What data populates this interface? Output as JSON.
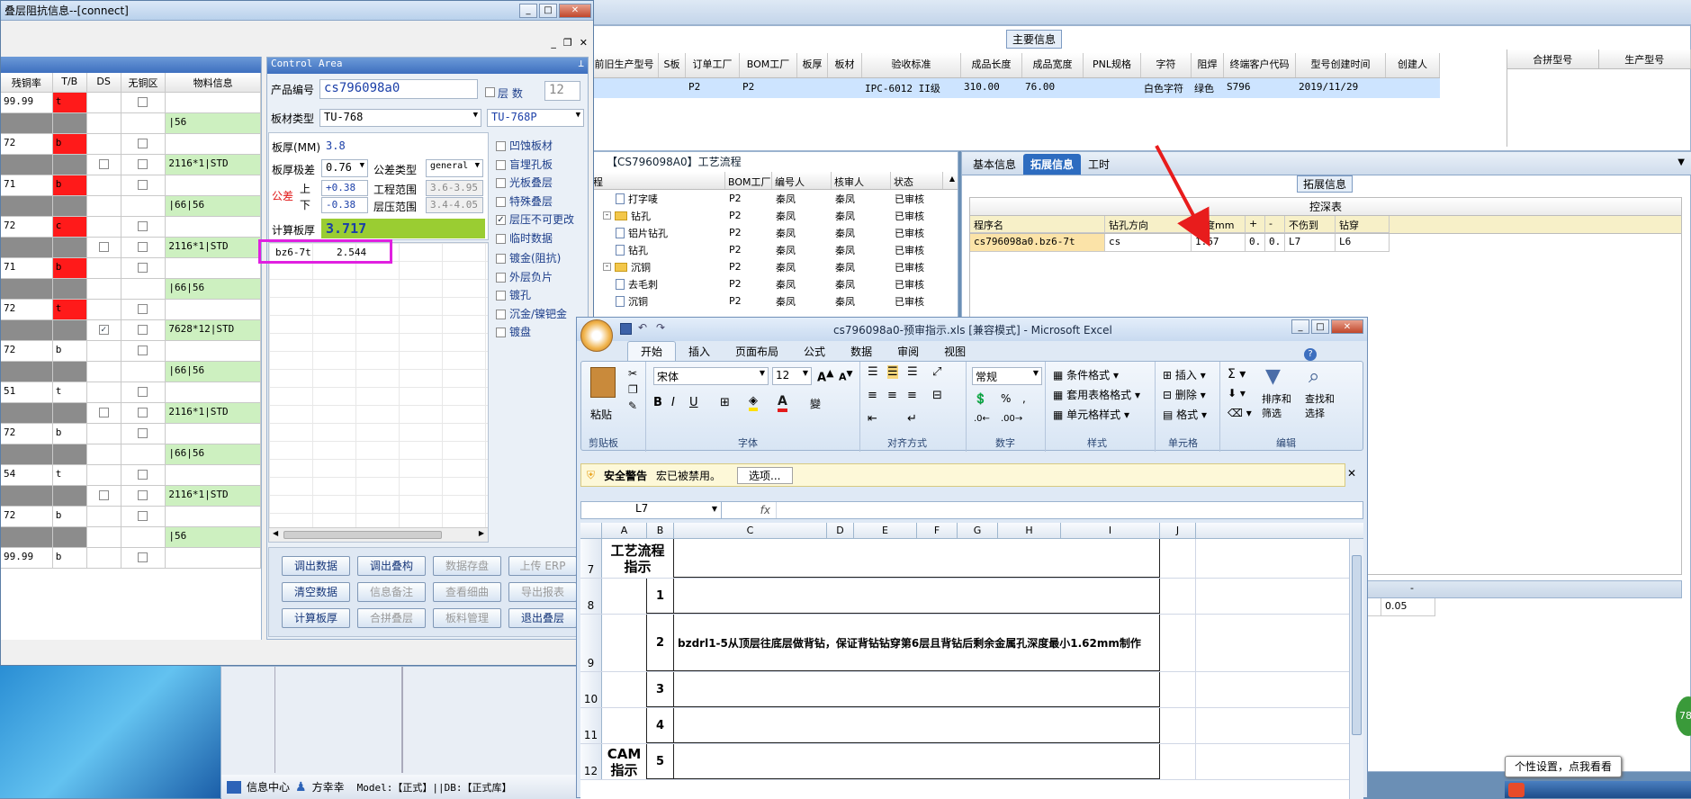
{
  "left_window": {
    "title": "叠层阻抗信息--[connect]"
  },
  "left_grid": {
    "headers": [
      "残铜率",
      "T/B",
      "DS",
      "无铜区",
      "物料信息"
    ],
    "rows": [
      {
        "pct": "99.99",
        "tb": "t",
        "color": "red",
        "ds": false,
        "dsshow": false,
        "nc": true,
        "mat": ""
      },
      {
        "pct": "",
        "tb": "",
        "color": "gray",
        "ds": false,
        "dsshow": false,
        "nc": false,
        "mat": "|56"
      },
      {
        "pct": "72",
        "tb": "b",
        "color": "red",
        "ds": false,
        "dsshow": false,
        "nc": true,
        "mat": ""
      },
      {
        "pct": "",
        "tb": "",
        "color": "gray",
        "ds": false,
        "dsshow": true,
        "nc": true,
        "mat": "2116*1|STD"
      },
      {
        "pct": "71",
        "tb": "b",
        "color": "red",
        "ds": false,
        "dsshow": false,
        "nc": true,
        "mat": ""
      },
      {
        "pct": "",
        "tb": "",
        "color": "gray",
        "ds": false,
        "dsshow": false,
        "nc": false,
        "mat": "|66|56"
      },
      {
        "pct": "72",
        "tb": "c",
        "color": "red",
        "ds": false,
        "dsshow": false,
        "nc": true,
        "mat": ""
      },
      {
        "pct": "",
        "tb": "",
        "color": "gray",
        "ds": false,
        "dsshow": true,
        "nc": true,
        "mat": "2116*1|STD"
      },
      {
        "pct": "71",
        "tb": "b",
        "color": "red",
        "ds": false,
        "dsshow": false,
        "nc": true,
        "mat": ""
      },
      {
        "pct": "",
        "tb": "",
        "color": "gray",
        "ds": false,
        "dsshow": false,
        "nc": false,
        "mat": "|66|56"
      },
      {
        "pct": "72",
        "tb": "t",
        "color": "red",
        "ds": false,
        "dsshow": false,
        "nc": true,
        "mat": ""
      },
      {
        "pct": "",
        "tb": "",
        "color": "gray",
        "ds": true,
        "dsshow": true,
        "nc": true,
        "mat": "7628*12|STD"
      },
      {
        "pct": "72",
        "tb": "b",
        "color": "white",
        "ds": false,
        "dsshow": false,
        "nc": true,
        "mat": ""
      },
      {
        "pct": "",
        "tb": "",
        "color": "gray",
        "ds": false,
        "dsshow": false,
        "nc": false,
        "mat": "|66|56"
      },
      {
        "pct": "51",
        "tb": "t",
        "color": "white",
        "ds": false,
        "dsshow": false,
        "nc": true,
        "mat": ""
      },
      {
        "pct": "",
        "tb": "",
        "color": "gray",
        "ds": false,
        "dsshow": true,
        "nc": true,
        "mat": "2116*1|STD"
      },
      {
        "pct": "72",
        "tb": "b",
        "color": "white",
        "ds": false,
        "dsshow": false,
        "nc": true,
        "mat": ""
      },
      {
        "pct": "",
        "tb": "",
        "color": "gray",
        "ds": false,
        "dsshow": false,
        "nc": false,
        "mat": "|66|56"
      },
      {
        "pct": "54",
        "tb": "t",
        "color": "white",
        "ds": false,
        "dsshow": false,
        "nc": true,
        "mat": ""
      },
      {
        "pct": "",
        "tb": "",
        "color": "gray",
        "ds": false,
        "dsshow": true,
        "nc": true,
        "mat": "2116*1|STD"
      },
      {
        "pct": "72",
        "tb": "b",
        "color": "white",
        "ds": false,
        "dsshow": false,
        "nc": true,
        "mat": ""
      },
      {
        "pct": "",
        "tb": "",
        "color": "gray",
        "ds": false,
        "dsshow": false,
        "nc": false,
        "mat": "|56"
      },
      {
        "pct": "99.99",
        "tb": "b",
        "color": "white",
        "ds": false,
        "dsshow": false,
        "nc": true,
        "mat": ""
      }
    ]
  },
  "control": {
    "title": "Control Area",
    "product_label": "产品编号",
    "product_value": "cs796098a0",
    "layers_label": "层 数",
    "layers_value": "12",
    "board_type_label": "板材类型",
    "board_type_value": "TU-768",
    "board_type2": "TU-768P",
    "thickness_label": "板厚(MM)",
    "thickness_value": "3.8",
    "limit_label": "板厚极差",
    "limit_value": "0.76",
    "tol_type_label": "公差类型",
    "tol_type_value": "general",
    "tol_label": "公差",
    "upper_label": "上",
    "lower_label": "下",
    "upper_value": "+0.38",
    "lower_value": "-0.38",
    "eng_range_label": "工程范围",
    "eng_range_value": "3.6-3.95",
    "press_range_label": "层压范围",
    "press_range_value": "3.4-4.05",
    "calc_label": "计算板厚",
    "calc_value": "3.717",
    "list_item": "bz6-7t",
    "list_value": "2.544",
    "checks": [
      {
        "label": "凹蚀板材",
        "on": false
      },
      {
        "label": "盲埋孔板",
        "on": false
      },
      {
        "label": "光板叠层",
        "on": false
      },
      {
        "label": "特殊叠层",
        "on": false
      },
      {
        "label": "层压不可更改",
        "on": true
      },
      {
        "label": "临时数据",
        "on": false
      },
      {
        "label": "镀金(阻抗)",
        "on": false
      },
      {
        "label": "外层负片",
        "on": false
      },
      {
        "label": "镀孔",
        "on": false
      },
      {
        "label": "沉金/镍钯金",
        "on": false
      },
      {
        "label": "镀盘",
        "on": false
      }
    ],
    "buttons": [
      [
        "调出数据",
        "调出叠构",
        "数据存盘",
        "上传 ERP"
      ],
      [
        "清空数据",
        "信息备注",
        "查看细曲",
        "导出报表"
      ],
      [
        "计算板厚",
        "合拼叠层",
        "板料管理",
        "退出叠层"
      ]
    ],
    "buttons_disabled": [
      [
        false,
        false,
        true,
        true
      ],
      [
        false,
        true,
        true,
        true
      ],
      [
        false,
        true,
        true,
        false
      ]
    ]
  },
  "main_info": {
    "title": "主要信息",
    "headers": [
      "前旧生产型号",
      "S板",
      "订单工厂",
      "BOM工厂",
      "板厚",
      "板材",
      "验收标准",
      "成品长度",
      "成品宽度",
      "PNL规格",
      "字符",
      "阻焊",
      "终端客户代码",
      "型号创建时间",
      "创建人"
    ],
    "row": [
      "",
      "",
      "P2",
      "P2",
      "",
      "",
      "IPC-6012 II级",
      "310.00",
      "76.00",
      "",
      "白色字符",
      "绿色",
      "S796",
      "2019/11/29",
      ""
    ],
    "right_headers": [
      "合拼型号",
      "生产型号"
    ]
  },
  "process": {
    "title": "【CS796098A0】工艺流程",
    "headers": [
      "程",
      "BOM工厂",
      "编号人",
      "核审人",
      "状态"
    ],
    "rows": [
      {
        "name": "打字唛",
        "indent": 2,
        "folder": false,
        "bom": "P2",
        "editor": "秦凤",
        "auditor": "秦凤",
        "status": "已审核"
      },
      {
        "name": "钻孔",
        "indent": 1,
        "folder": true,
        "bom": "P2",
        "editor": "秦凤",
        "auditor": "秦凤",
        "status": "已审核"
      },
      {
        "name": "铝片钻孔",
        "indent": 2,
        "folder": false,
        "bom": "P2",
        "editor": "秦凤",
        "auditor": "秦凤",
        "status": "已审核"
      },
      {
        "name": "钻孔",
        "indent": 2,
        "folder": false,
        "bom": "P2",
        "editor": "秦凤",
        "auditor": "秦凤",
        "status": "已审核"
      },
      {
        "name": "沉铜",
        "indent": 1,
        "folder": true,
        "bom": "P2",
        "editor": "秦凤",
        "auditor": "秦凤",
        "status": "已审核"
      },
      {
        "name": "去毛刺",
        "indent": 2,
        "folder": false,
        "bom": "P2",
        "editor": "秦凤",
        "auditor": "秦凤",
        "status": "已审核"
      },
      {
        "name": "沉铜",
        "indent": 2,
        "folder": false,
        "bom": "P2",
        "editor": "秦凤",
        "auditor": "秦凤",
        "status": "已审核"
      }
    ]
  },
  "ext": {
    "tabs": [
      "基本信息",
      "拓展信息",
      "工时"
    ],
    "active": 1,
    "title": "拓展信息",
    "sub_title": "控深表",
    "headers": [
      "程序名",
      "钻孔方向",
      "深度mm",
      "+",
      "-",
      "不伤到",
      "钻穿"
    ],
    "row": [
      "cs796098a0.bz6-7t",
      "cs",
      "1.67",
      "0.",
      "0.",
      "L7",
      "L6"
    ],
    "lower_header": "-",
    "lower_left": "05",
    "lower_value": "0.05"
  },
  "excel": {
    "title": "cs796098a0-预审指示.xls  [兼容模式] - Microsoft Excel",
    "ribbon_tabs": [
      "开始",
      "插入",
      "页面布局",
      "公式",
      "数据",
      "审阅",
      "视图"
    ],
    "clipboard": "剪贴板",
    "paste": "粘贴",
    "font_group": "字体",
    "font_name": "宋体",
    "font_size": "12",
    "align_group": "对齐方式",
    "number_group": "数字",
    "number_fmt": "常规",
    "style_group": "样式",
    "cond_fmt": "条件格式",
    "table_fmt": "套用表格格式",
    "cell_style": "单元格样式",
    "cells_group": "单元格",
    "insert": "插入",
    "delete": "删除",
    "format": "格式",
    "edit_group": "编辑",
    "sort": "排序和\n筛选",
    "find": "查找和\n选择",
    "warning_title": "安全警告",
    "warning_text": "宏已被禁用。",
    "options": "选项...",
    "namebox": "L7",
    "fx": "fx",
    "cols": [
      "A",
      "B",
      "C",
      "D",
      "E",
      "F",
      "G",
      "H",
      "I",
      "J"
    ],
    "rows": [
      {
        "num": "7",
        "a": "工艺流程\n指示",
        "b": "",
        "c": ""
      },
      {
        "num": "8",
        "a": "",
        "b": "1",
        "c": ""
      },
      {
        "num": "9",
        "a": "",
        "b": "2",
        "c": "bzdrl1-5从顶层往底层做背钻，保证背钻钻穿第6层且背钻后剩余金属孔深度最小1.62mm制作"
      },
      {
        "num": "10",
        "a": "",
        "b": "3",
        "c": ""
      },
      {
        "num": "11",
        "a": "",
        "b": "4",
        "c": ""
      },
      {
        "num": "12",
        "a": "CAM\n指示",
        "b": "5",
        "c": ""
      }
    ]
  },
  "taskbar": {
    "info_center": "信息中心",
    "user": "方幸幸",
    "model": "Model:【正式】||DB:【正式库】",
    "tooltip": "个性设置，点我看看",
    "badge": "78"
  },
  "colors": {
    "accent": "#1e5fb8",
    "highlight": "#cde4ff",
    "arrow": "#e81c1c",
    "magenta": "#e020e0"
  }
}
